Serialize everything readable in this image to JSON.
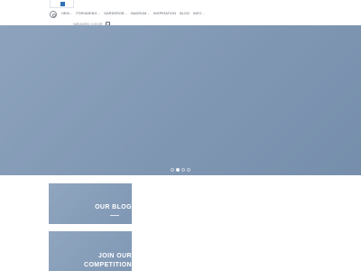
{
  "header": {
    "search_icon": "search-icon",
    "nav": [
      {
        "label": "HEM",
        "has_menu": true
      },
      {
        "label": "FÖRVARING",
        "has_menu": true
      },
      {
        "label": "GARDEROB",
        "has_menu": true
      },
      {
        "label": "BADRUM",
        "has_menu": true
      },
      {
        "label": "INSPIRATION",
        "has_menu": false
      },
      {
        "label": "BLOG",
        "has_menu": false
      },
      {
        "label": "INFO",
        "has_menu": true
      }
    ],
    "utility_text": "VARUKORG / 0,00 KR",
    "cart_count": "0"
  },
  "slider": {
    "slides_total": 4,
    "active_slide": 2
  },
  "cards": [
    {
      "title": "OUR BLOG"
    },
    {
      "title_line1": "JOIN OUR",
      "title_line2": "COMPETITION"
    }
  ],
  "colors": {
    "accent": "#2f72b8",
    "hero": "#8198b4",
    "card": "#8aa0bb"
  }
}
